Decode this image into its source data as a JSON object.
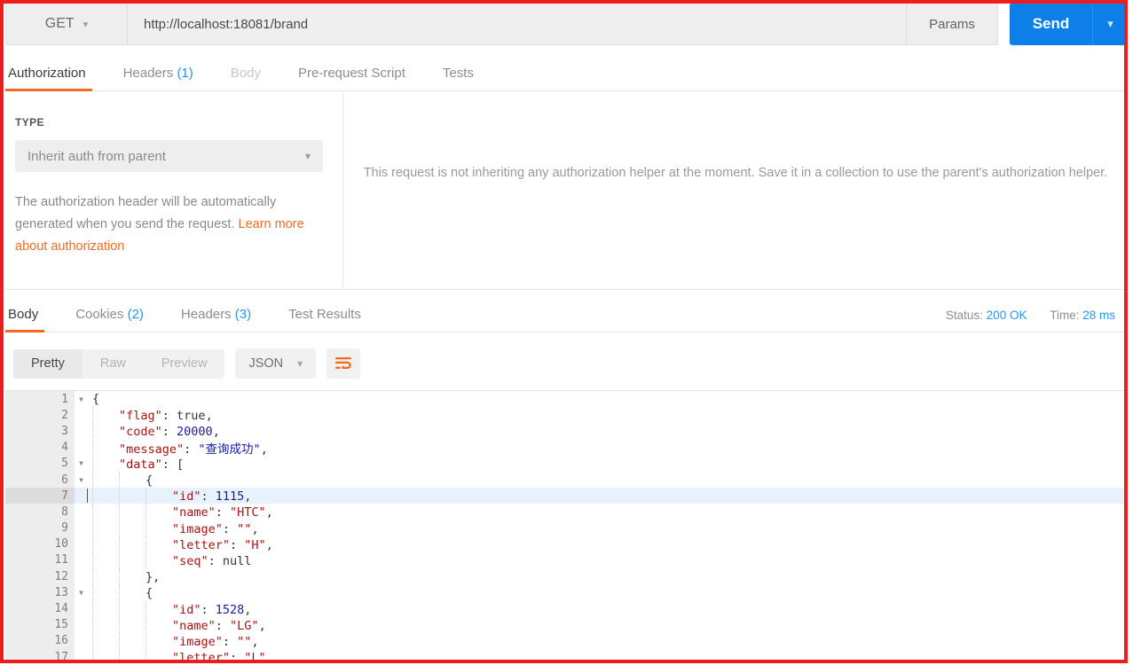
{
  "request": {
    "method": "GET",
    "method_caret": "chevron-down",
    "url": "http://localhost:18081/brand",
    "params_label": "Params",
    "send_label": "Send",
    "send_caret": "chevron-down",
    "tabs": [
      {
        "label": "Authorization",
        "count": "",
        "state": "active"
      },
      {
        "label": "Headers",
        "count": "(1)",
        "state": "normal"
      },
      {
        "label": "Body",
        "count": "",
        "state": "disabled"
      },
      {
        "label": "Pre-request Script",
        "count": "",
        "state": "normal"
      },
      {
        "label": "Tests",
        "count": "",
        "state": "normal"
      }
    ]
  },
  "auth": {
    "type_label": "TYPE",
    "type_value": "Inherit auth from parent",
    "type_caret": "chevron-down",
    "description_text": "The authorization header will be automatically generated when you send the request. ",
    "description_link": "Learn more about authorization",
    "info": "This request is not inheriting any authorization helper at the moment. Save it in a collection to use the parent's authorization helper."
  },
  "response": {
    "tabs": [
      {
        "label": "Body",
        "count": "",
        "state": "active"
      },
      {
        "label": "Cookies",
        "count": "(2)",
        "state": "normal"
      },
      {
        "label": "Headers",
        "count": "(3)",
        "state": "normal"
      },
      {
        "label": "Test Results",
        "count": "",
        "state": "normal"
      }
    ],
    "status_label": "Status:",
    "status_value": "200 OK",
    "time_label": "Time:",
    "time_value": "28 ms",
    "view_modes": [
      {
        "label": "Pretty",
        "state": "active"
      },
      {
        "label": "Raw",
        "state": "normal"
      },
      {
        "label": "Preview",
        "state": "normal"
      }
    ],
    "format": "JSON",
    "format_caret": "chevron-down",
    "wrap_icon": "word-wrap-icon"
  },
  "colors": {
    "accent_orange": "#f26b21",
    "send_blue": "#0e7fe8",
    "link_blue": "#2196f3",
    "annotation_red": "#ee1c1c"
  },
  "body_json": {
    "lines": [
      {
        "num": "1",
        "fold": true,
        "indent": 0,
        "tokens": [
          {
            "t": "{",
            "c": "p"
          }
        ]
      },
      {
        "num": "2",
        "fold": false,
        "indent": 1,
        "tokens": [
          {
            "t": "\"flag\"",
            "c": "k"
          },
          {
            "t": ": ",
            "c": "p"
          },
          {
            "t": "true",
            "c": "b"
          },
          {
            "t": ",",
            "c": "p"
          }
        ]
      },
      {
        "num": "3",
        "fold": false,
        "indent": 1,
        "tokens": [
          {
            "t": "\"code\"",
            "c": "k"
          },
          {
            "t": ": ",
            "c": "p"
          },
          {
            "t": "20000",
            "c": "n"
          },
          {
            "t": ",",
            "c": "p"
          }
        ]
      },
      {
        "num": "4",
        "fold": false,
        "indent": 1,
        "tokens": [
          {
            "t": "\"message\"",
            "c": "k"
          },
          {
            "t": ": ",
            "c": "p"
          },
          {
            "t": "\"查询成功\"",
            "c": "cn"
          },
          {
            "t": ",",
            "c": "p"
          }
        ]
      },
      {
        "num": "5",
        "fold": true,
        "indent": 1,
        "tokens": [
          {
            "t": "\"data\"",
            "c": "k"
          },
          {
            "t": ": ",
            "c": "p"
          },
          {
            "t": "[",
            "c": "p"
          }
        ]
      },
      {
        "num": "6",
        "fold": true,
        "indent": 2,
        "tokens": [
          {
            "t": "{",
            "c": "p"
          }
        ]
      },
      {
        "num": "7",
        "fold": false,
        "indent": 3,
        "highlight": true,
        "tokens": [
          {
            "t": "\"id\"",
            "c": "k"
          },
          {
            "t": ": ",
            "c": "p"
          },
          {
            "t": "1115",
            "c": "n"
          },
          {
            "t": ",",
            "c": "p"
          }
        ]
      },
      {
        "num": "8",
        "fold": false,
        "indent": 3,
        "tokens": [
          {
            "t": "\"name\"",
            "c": "k"
          },
          {
            "t": ": ",
            "c": "p"
          },
          {
            "t": "\"HTC\"",
            "c": "s"
          },
          {
            "t": ",",
            "c": "p"
          }
        ]
      },
      {
        "num": "9",
        "fold": false,
        "indent": 3,
        "tokens": [
          {
            "t": "\"image\"",
            "c": "k"
          },
          {
            "t": ": ",
            "c": "p"
          },
          {
            "t": "\"\"",
            "c": "s"
          },
          {
            "t": ",",
            "c": "p"
          }
        ]
      },
      {
        "num": "10",
        "fold": false,
        "indent": 3,
        "tokens": [
          {
            "t": "\"letter\"",
            "c": "k"
          },
          {
            "t": ": ",
            "c": "p"
          },
          {
            "t": "\"H\"",
            "c": "s"
          },
          {
            "t": ",",
            "c": "p"
          }
        ]
      },
      {
        "num": "11",
        "fold": false,
        "indent": 3,
        "tokens": [
          {
            "t": "\"seq\"",
            "c": "k"
          },
          {
            "t": ": ",
            "c": "p"
          },
          {
            "t": "null",
            "c": "nul"
          }
        ]
      },
      {
        "num": "12",
        "fold": false,
        "indent": 2,
        "tokens": [
          {
            "t": "},",
            "c": "p"
          }
        ]
      },
      {
        "num": "13",
        "fold": true,
        "indent": 2,
        "tokens": [
          {
            "t": "{",
            "c": "p"
          }
        ]
      },
      {
        "num": "14",
        "fold": false,
        "indent": 3,
        "tokens": [
          {
            "t": "\"id\"",
            "c": "k"
          },
          {
            "t": ": ",
            "c": "p"
          },
          {
            "t": "1528",
            "c": "n"
          },
          {
            "t": ",",
            "c": "p"
          }
        ]
      },
      {
        "num": "15",
        "fold": false,
        "indent": 3,
        "tokens": [
          {
            "t": "\"name\"",
            "c": "k"
          },
          {
            "t": ": ",
            "c": "p"
          },
          {
            "t": "\"LG\"",
            "c": "s"
          },
          {
            "t": ",",
            "c": "p"
          }
        ]
      },
      {
        "num": "16",
        "fold": false,
        "indent": 3,
        "tokens": [
          {
            "t": "\"image\"",
            "c": "k"
          },
          {
            "t": ": ",
            "c": "p"
          },
          {
            "t": "\"\"",
            "c": "s"
          },
          {
            "t": ",",
            "c": "p"
          }
        ]
      },
      {
        "num": "17",
        "fold": false,
        "indent": 3,
        "tokens": [
          {
            "t": "\"letter\"",
            "c": "k"
          },
          {
            "t": ": ",
            "c": "p"
          },
          {
            "t": "\"L\"",
            "c": "s"
          },
          {
            "t": ",",
            "c": "p"
          }
        ]
      }
    ]
  }
}
